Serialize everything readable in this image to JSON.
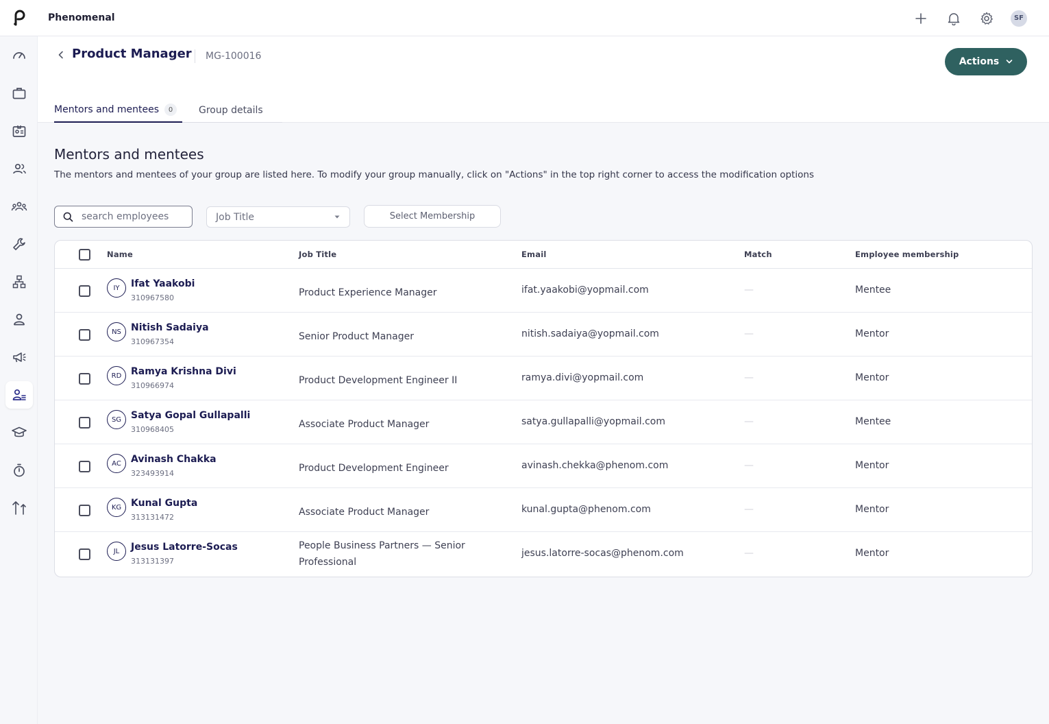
{
  "app": {
    "name": "Phenomenal",
    "user_initials": "SF"
  },
  "header": {
    "title": "Product Manager",
    "group_id": "MG-100016",
    "actions_label": "Actions",
    "tabs": [
      {
        "label": "Mentors and mentees",
        "count": "0"
      },
      {
        "label": "Group details"
      }
    ]
  },
  "section": {
    "title": "Mentors and mentees",
    "description": "The mentors and mentees of your group are listed here. To modify your group manually, click on \"Actions\" in the top right corner to access the modification options"
  },
  "filters": {
    "search_placeholder": "search employees",
    "job_title_select": "Job Title",
    "membership_select": "Select Membership"
  },
  "table": {
    "columns": [
      "Name",
      "Job Title",
      "Email",
      "Match",
      "Employee membership"
    ],
    "rows": [
      {
        "initials": "IY",
        "name": "Ifat Yaakobi",
        "id": "310967580",
        "job": "Product Experience Manager",
        "email": "ifat.yaakobi@yopmail.com",
        "match": "—",
        "membership": "Mentee"
      },
      {
        "initials": "NS",
        "name": "Nitish Sadaiya",
        "id": "310967354",
        "job": "Senior Product Manager",
        "email": "nitish.sadaiya@yopmail.com",
        "match": "—",
        "membership": "Mentor"
      },
      {
        "initials": "RD",
        "name": "Ramya Krishna Divi",
        "id": "310966974",
        "job": "Product Development Engineer II",
        "email": "ramya.divi@yopmail.com",
        "match": "—",
        "membership": "Mentor"
      },
      {
        "initials": "SG",
        "name": "Satya Gopal Gullapalli",
        "id": "310968405",
        "job": "Associate Product Manager",
        "email": "satya.gullapalli@yopmail.com",
        "match": "—",
        "membership": "Mentee"
      },
      {
        "initials": "AC",
        "name": "Avinash Chakka",
        "id": "323493914",
        "job": "Product Development Engineer",
        "email": "avinash.chekka@phenom.com",
        "match": "—",
        "membership": "Mentor"
      },
      {
        "initials": "KG",
        "name": "Kunal Gupta",
        "id": "313131472",
        "job": "Associate Product Manager",
        "email": "kunal.gupta@phenom.com",
        "match": "—",
        "membership": "Mentor"
      },
      {
        "initials": "JL",
        "name": "Jesus Latorre-Socas",
        "id": "313131397",
        "job": "People Business Partners — Senior Professional",
        "email": "jesus.latorre-socas@phenom.com",
        "match": "—",
        "membership": "Mentor"
      }
    ]
  },
  "icons": {
    "sidebar": [
      "dashboard-icon",
      "briefcase-icon",
      "id-card-icon",
      "people-icon",
      "team-icon",
      "wrench-icon",
      "org-chart-icon",
      "person-icon",
      "megaphone-icon",
      "mentorship-icon",
      "graduation-cap-icon",
      "timer-icon",
      "sort-arrows-icon"
    ],
    "top": [
      "plus-icon",
      "bell-icon",
      "gear-icon"
    ]
  },
  "colors": {
    "accent": "#2f6160",
    "primary_text": "#1c1c52"
  }
}
